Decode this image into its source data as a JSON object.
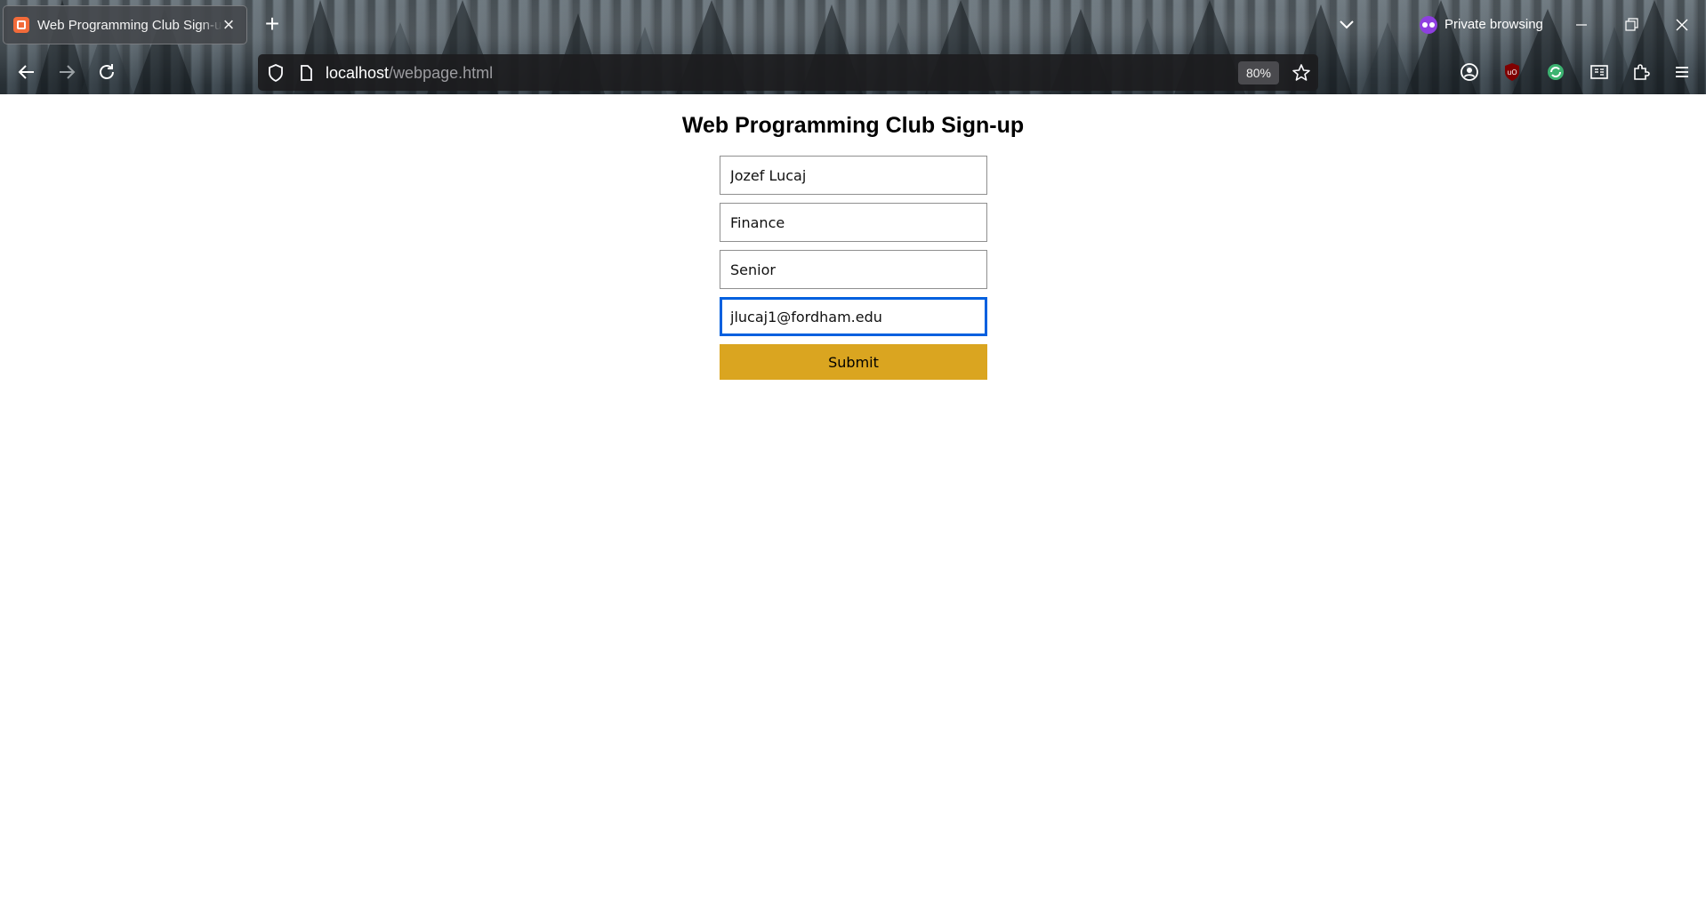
{
  "browser": {
    "tab_title": "Web Programming Club Sign-up",
    "tab_close": "×",
    "new_tab": "+",
    "private_label": "Private browsing",
    "url_host": "localhost",
    "url_path": "/webpage.html",
    "zoom": "80%",
    "icons": [
      "back-icon",
      "forward-icon",
      "reload-icon",
      "shield-icon",
      "page-icon",
      "bookmark-star-icon",
      "account-icon",
      "ublock-icon",
      "sync-icon",
      "reader-icon",
      "extensions-icon",
      "menu-icon"
    ]
  },
  "page": {
    "heading": "Web Programming Club Sign-up",
    "fields": {
      "name": "Jozef Lucaj",
      "major": "Finance",
      "year": "Senior",
      "email": "jlucaj1@fordham.edu"
    },
    "submit_label": "Submit"
  },
  "colors": {
    "submit_bg": "#daa520",
    "focus_ring": "#0060df",
    "private_accent": "#8e3fe0"
  }
}
